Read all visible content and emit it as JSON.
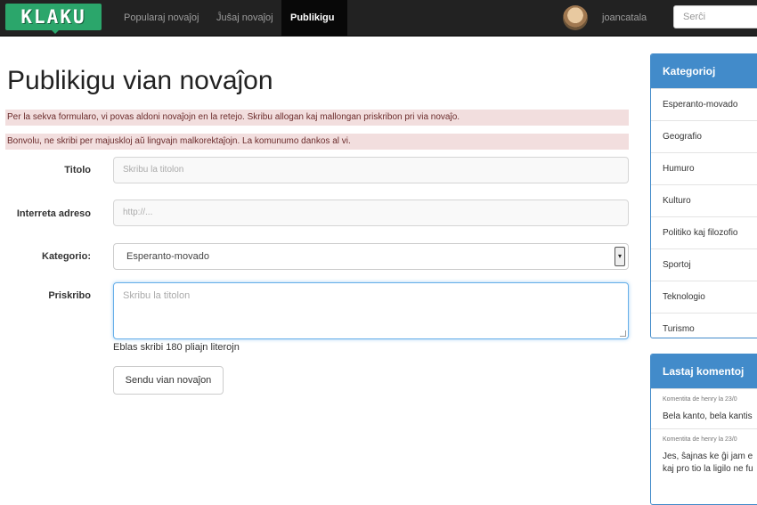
{
  "navbar": {
    "logo": "KLAKU",
    "items": [
      {
        "label": "Popularaj novaĵoj"
      },
      {
        "label": "Ĵuŝaj novaĵoj"
      },
      {
        "label": "Publikigu"
      }
    ],
    "username": "joancatala",
    "search_placeholder": "Serĉi"
  },
  "main": {
    "title": "Publikigu vian novaĵon",
    "alerts": [
      "Per la sekva formularo, vi povas aldoni novaĵojn en la retejo. Skribu allogan kaj mallongan priskribon pri via novaĵo.",
      "Bonvolu, ne skribi per majuskloj aŭ lingvajn malkorektaĵojn. La komunumo dankos al vi."
    ],
    "form": {
      "title_label": "Titolo",
      "title_placeholder": "Skribu la titolon",
      "url_label": "Interreta adreso",
      "url_placeholder": "http://...",
      "category_label": "Kategorio:",
      "category_value": "Esperanto-movado",
      "description_label": "Priskribo",
      "description_placeholder": "Skribu la titolon",
      "help_text": "Eblas skribi 180 pliajn literojn",
      "submit_label": "Sendu vian novaĵon"
    }
  },
  "sidebar": {
    "categories_title": "Kategorioj",
    "categories": [
      "Esperanto-movado",
      "Geografio",
      "Humuro",
      "Kulturo",
      "Politiko kaj filozofio",
      "Sportoj",
      "Teknologio",
      "Turismo"
    ],
    "comments_title": "Lastaj komentoj",
    "comments": [
      {
        "meta": "Komentita de henry la 23/0",
        "text": "Bela kanto, bela kantis"
      },
      {
        "meta": "Komentita de henry la 23/0",
        "text": "Jes, ŝajnas ke ĝi jam e",
        "text2": "kaj pro tio la ligilo ne fu"
      }
    ]
  },
  "colors": {
    "navbar": "#222222",
    "logo": "#2ba66b",
    "alert_bg": "#f2dede",
    "panel": "#428bca",
    "focus": "#66afe9"
  },
  "icons": [
    "select-arrow-icon",
    "resize-handle-icon"
  ]
}
